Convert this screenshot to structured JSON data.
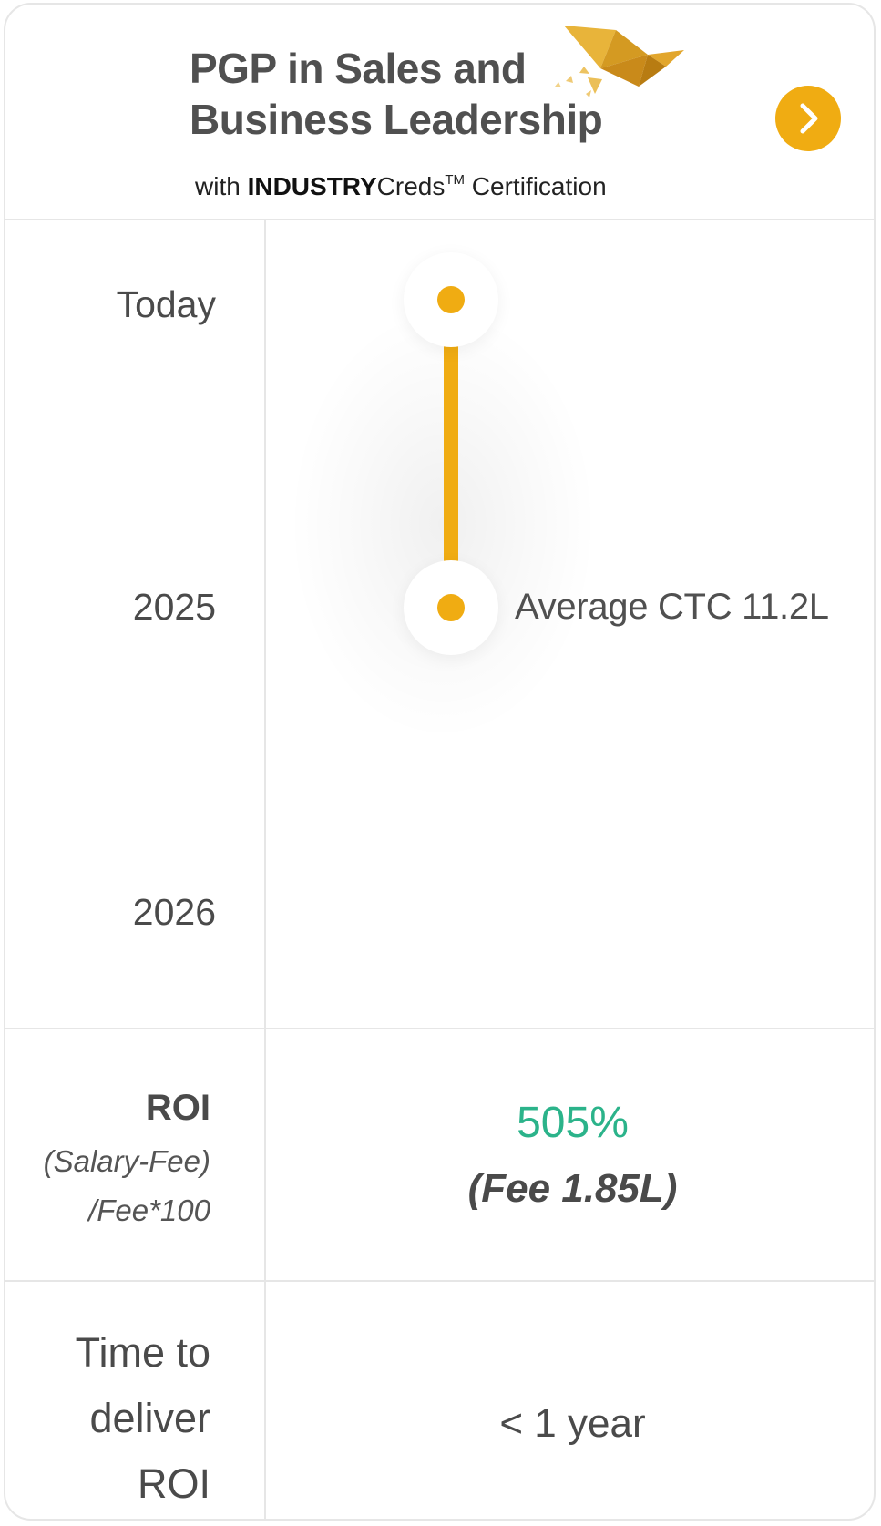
{
  "header": {
    "title": "PGP in Sales and Business Leadership",
    "subtitle_prefix": "with ",
    "subtitle_brand": "INDUSTRY",
    "subtitle_brand_suffix": "Creds",
    "subtitle_tm": "TM",
    "subtitle_suffix": " Certification",
    "next_icon": "chevron-right-icon",
    "logo_icon": "origami-bird-icon",
    "accent_color": "#f0ac12"
  },
  "timeline": {
    "labels": [
      "Today",
      "2025",
      "2026"
    ],
    "milestone_text": "Average CTC 11.2L"
  },
  "roi": {
    "label": "ROI",
    "formula_line1": "(Salary-Fee)",
    "formula_line2": "/Fee*100",
    "value": "505%",
    "value_color": "#2bb38a",
    "fee": "(Fee 1.85L)"
  },
  "time_to_roi": {
    "label_line1": "Time to",
    "label_line2": "deliver",
    "label_line3": "ROI",
    "value": "< 1 year"
  }
}
